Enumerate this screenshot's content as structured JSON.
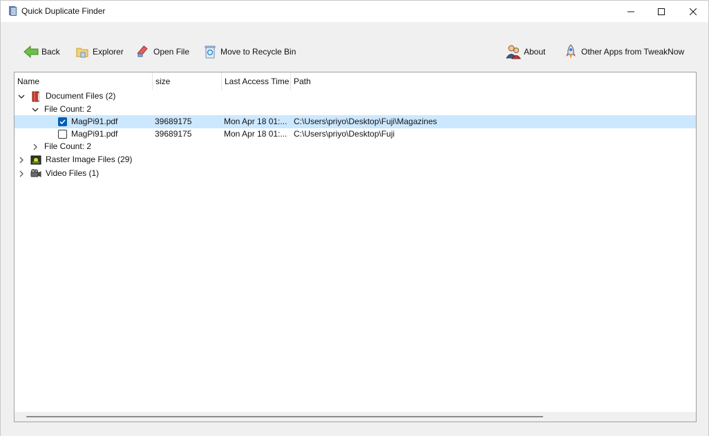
{
  "window": {
    "title": "Quick Duplicate Finder",
    "controls": [
      "minimize",
      "maximize",
      "close"
    ]
  },
  "toolbar": {
    "back_label": "Back",
    "explorer_label": "Explorer",
    "open_file_label": "Open File",
    "recycle_label": "Move to Recycle Bin",
    "about_label": "About",
    "other_apps_label": "Other Apps from TweakNow"
  },
  "columns": {
    "name": "Name",
    "size": "size",
    "last_access": "Last Access Time",
    "path": "Path"
  },
  "tree": {
    "document_group": {
      "label": "Document Files (2)",
      "expanded": true,
      "icon": "document-book-icon"
    },
    "file_count_1": {
      "label": "File Count: 2",
      "expanded": true
    },
    "file_a": {
      "name": "MagPi91.pdf",
      "size": "39689175",
      "last_access": "Mon Apr 18 01:...",
      "path": "C:\\Users\\priyo\\Desktop\\Fuji\\Magazines",
      "checked": true,
      "selected": true
    },
    "file_b": {
      "name": "MagPi91.pdf",
      "size": "39689175",
      "last_access": "Mon Apr 18 01:...",
      "path": "C:\\Users\\priyo\\Desktop\\Fuji",
      "checked": false,
      "selected": false
    },
    "file_count_2": {
      "label": "File Count: 2",
      "expanded": false
    },
    "raster_group": {
      "label": "Raster Image Files (29)",
      "expanded": false,
      "icon": "image-icon"
    },
    "video_group": {
      "label": "Video Files (1)",
      "expanded": false,
      "icon": "video-camera-icon"
    }
  },
  "colors": {
    "selection": "#cce8ff",
    "checkbox_accent": "#005fb8",
    "window_bg": "#f0f0f0",
    "panel_bg": "#ffffff"
  }
}
